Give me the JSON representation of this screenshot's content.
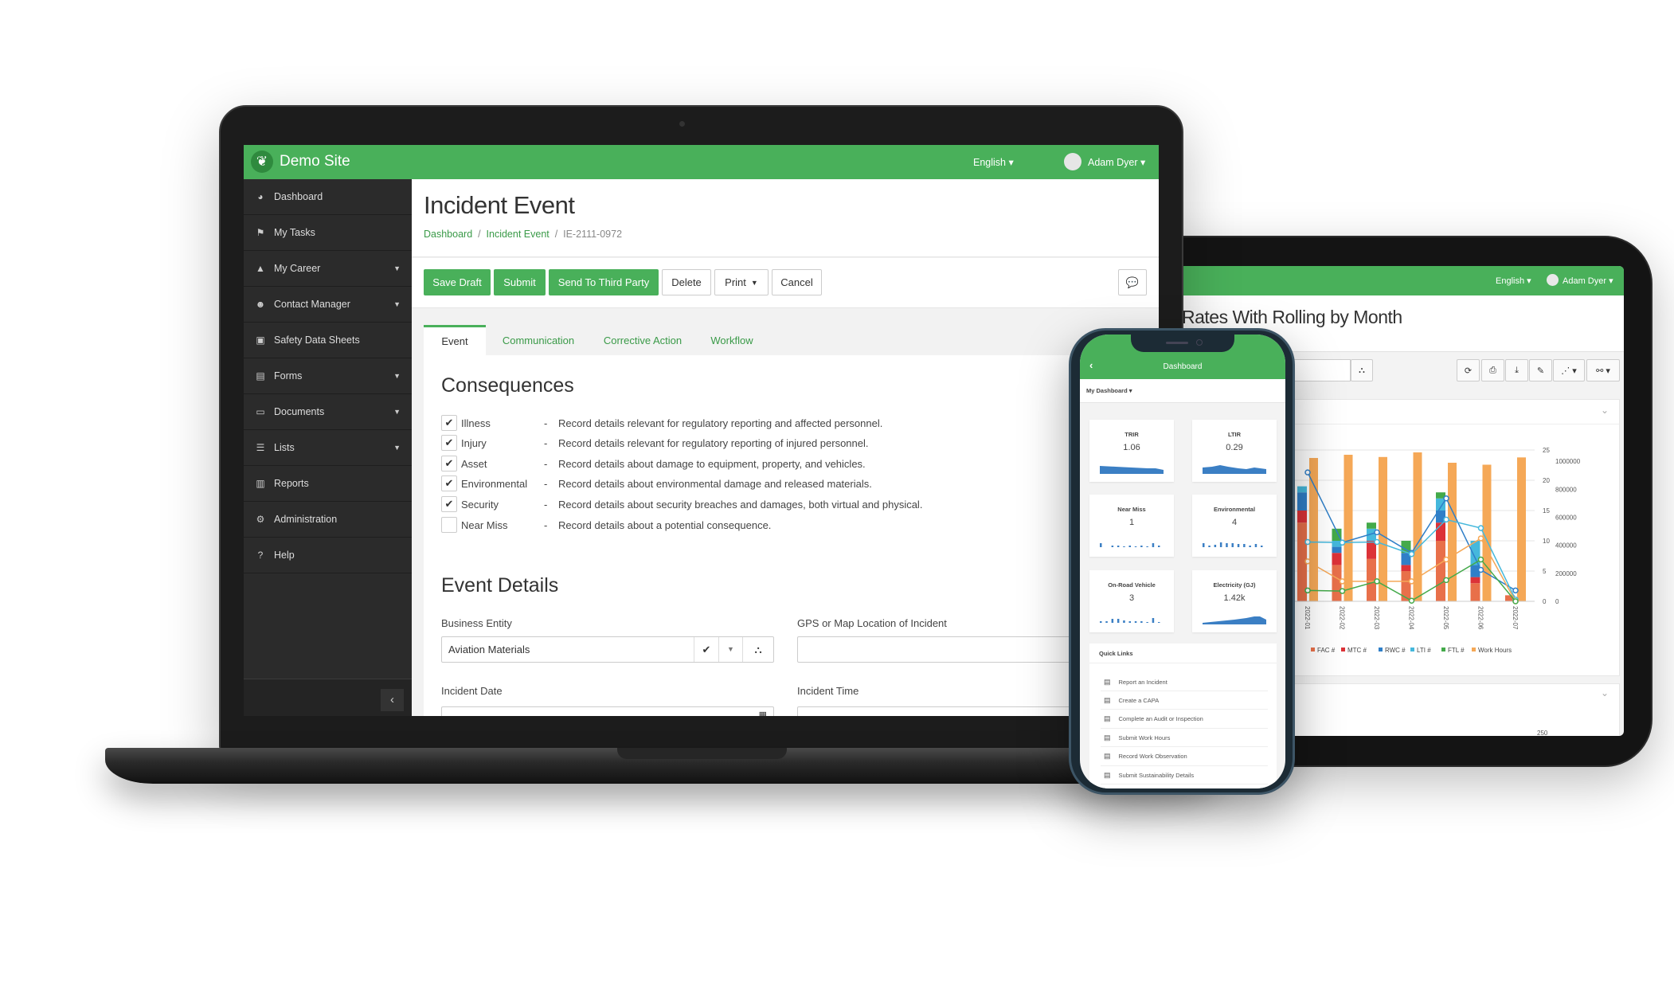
{
  "laptop": {
    "header": {
      "site_name": "Demo Site",
      "language": "English",
      "user": "Adam Dyer"
    },
    "sidebar": {
      "items": [
        {
          "label": "Dashboard",
          "icon": "dashboard-icon",
          "glyph": "◕",
          "caret": false
        },
        {
          "label": "My Tasks",
          "icon": "flag-icon",
          "glyph": "⚑",
          "caret": false
        },
        {
          "label": "My Career",
          "icon": "graduation-cap-icon",
          "glyph": "▲",
          "caret": true
        },
        {
          "label": "Contact Manager",
          "icon": "users-icon",
          "glyph": "☻",
          "caret": true
        },
        {
          "label": "Safety Data Sheets",
          "icon": "briefcase-icon",
          "glyph": "▣",
          "caret": false
        },
        {
          "label": "Forms",
          "icon": "form-icon",
          "glyph": "▤",
          "caret": true
        },
        {
          "label": "Documents",
          "icon": "folder-icon",
          "glyph": "▭",
          "caret": true
        },
        {
          "label": "Lists",
          "icon": "list-icon",
          "glyph": "☰",
          "caret": true
        },
        {
          "label": "Reports",
          "icon": "bar-chart-icon",
          "glyph": "▥",
          "caret": false
        },
        {
          "label": "Administration",
          "icon": "gear-icon",
          "glyph": "⚙",
          "caret": false
        },
        {
          "label": "Help",
          "icon": "question-icon",
          "glyph": "?",
          "caret": false
        }
      ],
      "collapse": "‹"
    },
    "page": {
      "title": "Incident Event",
      "breadcrumb": [
        "Dashboard",
        "Incident Event",
        "IE-2111-0972"
      ],
      "buttons": {
        "save_draft": "Save Draft",
        "submit": "Submit",
        "send": "Send To Third Party",
        "delete": "Delete",
        "print": "Print",
        "cancel": "Cancel"
      },
      "tabs": [
        "Event",
        "Communication",
        "Corrective Action",
        "Workflow"
      ],
      "active_tab": "Event",
      "consequences": {
        "heading": "Consequences",
        "items": [
          {
            "label": "Illness",
            "checked": true,
            "desc": "Record details relevant for regulatory reporting and affected personnel."
          },
          {
            "label": "Injury",
            "checked": true,
            "desc": "Record details relevant for regulatory reporting of injured personnel."
          },
          {
            "label": "Asset",
            "checked": true,
            "desc": "Record details about damage to equipment, property, and vehicles."
          },
          {
            "label": "Environmental",
            "checked": true,
            "desc": "Record details about environmental damage and released materials."
          },
          {
            "label": "Security",
            "checked": true,
            "desc": "Record details about security breaches and damages, both virtual and physical."
          },
          {
            "label": "Near Miss",
            "checked": false,
            "desc": "Record details about a potential consequence."
          }
        ]
      },
      "event_details": {
        "heading": "Event Details",
        "business_entity_label": "Business Entity",
        "business_entity_value": "Aviation Materials",
        "gps_label": "GPS or Map Location of Incident",
        "gps_value": "",
        "date_label": "Incident Date",
        "time_label": "Incident Time"
      }
    }
  },
  "tablet": {
    "language": "English",
    "user": "Adam Dyer",
    "title": "Rates With Rolling by Month",
    "second_panel_tick": "250"
  },
  "phone": {
    "title": "Dashboard",
    "dashboard_select": "My Dashboard",
    "cards": [
      {
        "title": "TRIR",
        "value": "1.06",
        "spark": "area"
      },
      {
        "title": "LTIR",
        "value": "0.29",
        "spark": "area"
      },
      {
        "title": "Near Miss",
        "value": "1",
        "spark": "bars"
      },
      {
        "title": "Environmental",
        "value": "4",
        "spark": "bars"
      },
      {
        "title": "On-Road Vehicle",
        "value": "3",
        "spark": "bars"
      },
      {
        "title": "Electricity (GJ)",
        "value": "1.42k",
        "spark": "area"
      }
    ],
    "quick_links_title": "Quick Links",
    "quick_links": [
      "Report an Incident",
      "Create a CAPA",
      "Complete an Audit or Inspection",
      "Submit Work Hours",
      "Record Work Observation",
      "Submit Sustainability Details"
    ]
  },
  "colors": {
    "brand_green": "#49b05a",
    "sidebar": "#2b2b2b"
  },
  "chart_data": {
    "type": "bar",
    "categories": [
      "2022-01",
      "2022-02",
      "2022-03",
      "2022-04",
      "2022-05",
      "2022-06",
      "2022-07"
    ],
    "left_axis": {
      "ticks": [
        "0",
        "5",
        "10",
        "15",
        "20",
        "25"
      ],
      "range": [
        0,
        25
      ]
    },
    "right_axis": {
      "ticks": [
        "0",
        "200000",
        "400000",
        "600000",
        "800000",
        "1000000"
      ],
      "range": [
        0,
        1080000
      ]
    },
    "stacked_series": [
      {
        "name": "FAC #",
        "color": "#e8704a",
        "values": [
          13,
          6,
          7,
          5,
          10,
          3,
          1
        ]
      },
      {
        "name": "MTC #",
        "color": "#dc3238",
        "values": [
          2,
          2,
          3,
          1,
          3,
          1,
          0
        ]
      },
      {
        "name": "RWC #",
        "color": "#2f7fc8",
        "values": [
          3,
          1,
          0,
          2,
          2,
          2,
          0
        ]
      },
      {
        "name": "LTI #",
        "color": "#45b8dc",
        "values": [
          1,
          1,
          2,
          0,
          2,
          4,
          0
        ]
      },
      {
        "name": "FTL #",
        "color": "#44aa4a",
        "values": [
          0,
          2,
          1,
          2,
          1,
          0,
          0
        ]
      }
    ],
    "bar_series": {
      "name": "Work Hours",
      "color": "#f5a857",
      "values": [
        1023000,
        1046000,
        1030000,
        1063000,
        989000,
        975000,
        1027000
      ]
    },
    "line_series": [
      {
        "color": "#2f7fc8",
        "values": [
          21.3,
          9.7,
          11.4,
          8.0,
          17.0,
          5.2,
          1.8
        ]
      },
      {
        "color": "#45b8dc",
        "values": [
          9.8,
          9.7,
          9.8,
          7.8,
          13.5,
          12.1,
          0.3
        ]
      },
      {
        "color": "#f5a857",
        "values": [
          6.6,
          3.3,
          3.3,
          3.3,
          6.9,
          10.4,
          0
        ]
      },
      {
        "color": "#44aa4a",
        "values": [
          1.8,
          1.7,
          3.3,
          0.1,
          3.5,
          6.9,
          0
        ]
      }
    ],
    "legend": "bottom",
    "grid": true
  }
}
